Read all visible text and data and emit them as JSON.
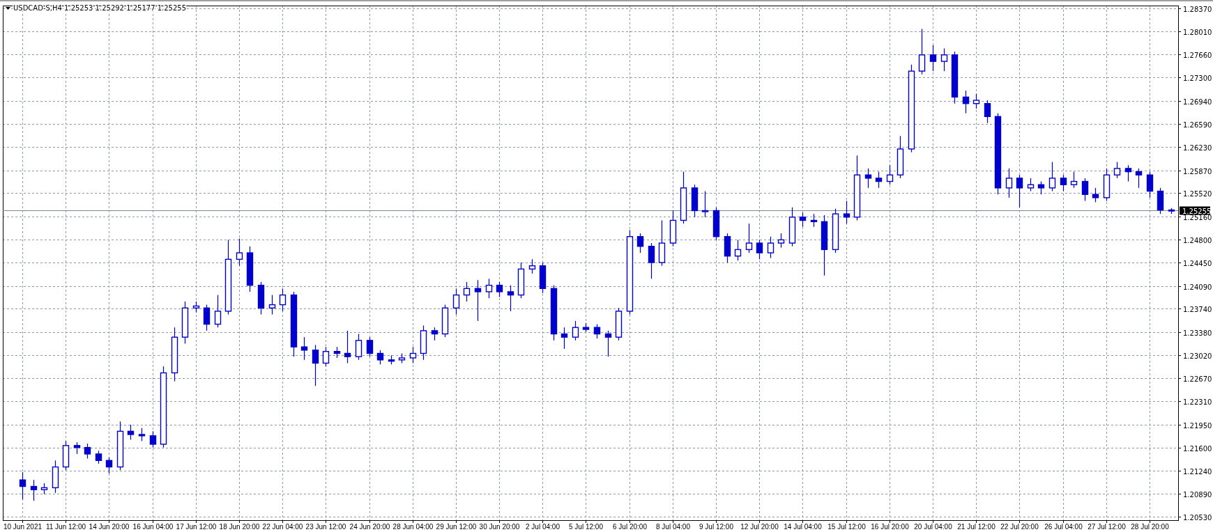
{
  "chart": {
    "quote": [
      "1.25253",
      "1.25292",
      "1.25177",
      "1.25255"
    ],
    "chart_data": {
      "type": "candlestick",
      "title": "USDCAD-S,H4",
      "grid": true,
      "ylim": [
        1.2048,
        1.2841
      ],
      "categories": [
        "10 Jun 2021",
        null,
        null,
        null,
        "11 Jun 12:00",
        null,
        null,
        null,
        "14 Jun 20:00",
        null,
        null,
        null,
        "16 Jun 04:00",
        null,
        null,
        null,
        "17 Jun 12:00",
        null,
        null,
        null,
        "18 Jun 20:00",
        null,
        null,
        null,
        "22 Jun 04:00",
        null,
        null,
        null,
        "23 Jun 12:00",
        null,
        null,
        null,
        "24 Jun 20:00",
        null,
        null,
        null,
        "28 Jun 04:00",
        null,
        null,
        null,
        "29 Jun 12:00",
        null,
        null,
        null,
        "30 Jun 20:00",
        null,
        null,
        null,
        "2 Jul 04:00",
        null,
        null,
        null,
        "5 Jul 12:00",
        null,
        null,
        null,
        "6 Jul 20:00",
        null,
        null,
        null,
        "8 Jul 04:00",
        null,
        null,
        null,
        "9 Jul 12:00",
        null,
        null,
        null,
        "12 Jul 20:00",
        null,
        null,
        null,
        "14 Jul 04:00",
        null,
        null,
        null,
        "15 Jul 12:00",
        null,
        null,
        null,
        "16 Jul 20:00",
        null,
        null,
        null,
        "20 Jul 04:00",
        null,
        null,
        null,
        "21 Jul 12:00",
        null,
        null,
        null,
        "22 Jul 20:00",
        null,
        null,
        null,
        "26 Jul 04:00",
        null,
        null,
        null,
        "27 Jul 12:00",
        null,
        null,
        null,
        "28 Jul 20:00",
        null,
        null
      ],
      "ohlc": [
        [
          1.211,
          1.2122,
          1.208,
          1.21
        ],
        [
          1.21,
          1.211,
          1.2078,
          1.2095
        ],
        [
          1.2095,
          1.2105,
          1.2088,
          1.2098
        ],
        [
          1.2098,
          1.214,
          1.209,
          1.213
        ],
        [
          1.213,
          1.217,
          1.2125,
          1.2163
        ],
        [
          1.2163,
          1.2168,
          1.215,
          1.216
        ],
        [
          1.216,
          1.2166,
          1.2143,
          1.215
        ],
        [
          1.215,
          1.2155,
          1.2135,
          1.214
        ],
        [
          1.214,
          1.2145,
          1.212,
          1.213
        ],
        [
          1.213,
          1.22,
          1.2125,
          1.2185
        ],
        [
          1.2185,
          1.2195,
          1.2172,
          1.218
        ],
        [
          1.218,
          1.219,
          1.217,
          1.2178
        ],
        [
          1.2178,
          1.2185,
          1.216,
          1.2165
        ],
        [
          1.2165,
          1.2285,
          1.216,
          1.2275
        ],
        [
          1.2275,
          1.2345,
          1.2262,
          1.233
        ],
        [
          1.233,
          1.2385,
          1.232,
          1.2375
        ],
        [
          1.2375,
          1.2385,
          1.2368,
          1.2378
        ],
        [
          1.2375,
          1.238,
          1.234,
          1.235
        ],
        [
          1.235,
          1.2395,
          1.2345,
          1.237
        ],
        [
          1.237,
          1.248,
          1.2365,
          1.245
        ],
        [
          1.245,
          1.2482,
          1.244,
          1.246
        ],
        [
          1.246,
          1.247,
          1.24,
          1.241
        ],
        [
          1.241,
          1.2415,
          1.2365,
          1.2375
        ],
        [
          1.2375,
          1.2395,
          1.2365,
          1.238
        ],
        [
          1.238,
          1.2405,
          1.237,
          1.2395
        ],
        [
          1.2395,
          1.24,
          1.23,
          1.2315
        ],
        [
          1.2315,
          1.233,
          1.2295,
          1.231
        ],
        [
          1.231,
          1.2318,
          1.2255,
          1.229
        ],
        [
          1.229,
          1.2315,
          1.2285,
          1.2308
        ],
        [
          1.2308,
          1.2315,
          1.2298,
          1.2305
        ],
        [
          1.2305,
          1.234,
          1.229,
          1.23
        ],
        [
          1.23,
          1.2335,
          1.2295,
          1.2325
        ],
        [
          1.2325,
          1.233,
          1.23,
          1.2305
        ],
        [
          1.2305,
          1.231,
          1.2288,
          1.2295
        ],
        [
          1.2295,
          1.2302,
          1.2288,
          1.2293
        ],
        [
          1.2295,
          1.2305,
          1.229,
          1.2298
        ],
        [
          1.2298,
          1.2315,
          1.229,
          1.2305
        ],
        [
          1.2305,
          1.2348,
          1.2295,
          1.234
        ],
        [
          1.234,
          1.2345,
          1.2325,
          1.2335
        ],
        [
          1.2335,
          1.238,
          1.233,
          1.2375
        ],
        [
          1.2375,
          1.2405,
          1.2365,
          1.2395
        ],
        [
          1.2395,
          1.2415,
          1.2385,
          1.2405
        ],
        [
          1.2405,
          1.2418,
          1.2355,
          1.24
        ],
        [
          1.24,
          1.242,
          1.239,
          1.241
        ],
        [
          1.241,
          1.2415,
          1.2392,
          1.24
        ],
        [
          1.24,
          1.241,
          1.237,
          1.2395
        ],
        [
          1.2395,
          1.2445,
          1.239,
          1.2435
        ],
        [
          1.2435,
          1.245,
          1.2428,
          1.244
        ],
        [
          1.244,
          1.2445,
          1.2398,
          1.2405
        ],
        [
          1.2405,
          1.241,
          1.2325,
          1.2335
        ],
        [
          1.2335,
          1.2345,
          1.2312,
          1.233
        ],
        [
          1.233,
          1.2355,
          1.2325,
          1.2345
        ],
        [
          1.2345,
          1.2352,
          1.2338,
          1.2342
        ],
        [
          1.2345,
          1.235,
          1.2328,
          1.2335
        ],
        [
          1.2335,
          1.234,
          1.23,
          1.233
        ],
        [
          1.233,
          1.2375,
          1.2325,
          1.237
        ],
        [
          1.237,
          1.2495,
          1.2365,
          1.2485
        ],
        [
          1.2485,
          1.249,
          1.246,
          1.247
        ],
        [
          1.247,
          1.2475,
          1.242,
          1.2445
        ],
        [
          1.2445,
          1.251,
          1.244,
          1.2475
        ],
        [
          1.2475,
          1.2525,
          1.247,
          1.251
        ],
        [
          1.251,
          1.2585,
          1.2505,
          1.256
        ],
        [
          1.256,
          1.2565,
          1.2515,
          1.2525
        ],
        [
          1.2525,
          1.2555,
          1.2515,
          1.2525
        ],
        [
          1.2525,
          1.253,
          1.248,
          1.2485
        ],
        [
          1.2485,
          1.249,
          1.2445,
          1.2455
        ],
        [
          1.2455,
          1.248,
          1.2448,
          1.2465
        ],
        [
          1.2465,
          1.2505,
          1.246,
          1.2475
        ],
        [
          1.2475,
          1.248,
          1.245,
          1.246
        ],
        [
          1.246,
          1.2485,
          1.2452,
          1.2475
        ],
        [
          1.2475,
          1.249,
          1.2468,
          1.248
        ],
        [
          1.2475,
          1.253,
          1.247,
          1.2515
        ],
        [
          1.2515,
          1.2522,
          1.25,
          1.251
        ],
        [
          1.251,
          1.252,
          1.25,
          1.2508
        ],
        [
          1.2508,
          1.2518,
          1.2425,
          1.2465
        ],
        [
          1.2465,
          1.2528,
          1.246,
          1.252
        ],
        [
          1.252,
          1.254,
          1.2505,
          1.2515
        ],
        [
          1.2515,
          1.261,
          1.251,
          1.258
        ],
        [
          1.258,
          1.259,
          1.256,
          1.2575
        ],
        [
          1.2575,
          1.2585,
          1.256,
          1.257
        ],
        [
          1.257,
          1.2595,
          1.2565,
          1.258
        ],
        [
          1.258,
          1.264,
          1.2575,
          1.262
        ],
        [
          1.262,
          1.275,
          1.2615,
          1.274
        ],
        [
          1.274,
          1.2805,
          1.2735,
          1.2765
        ],
        [
          1.2765,
          1.278,
          1.274,
          1.2755
        ],
        [
          1.2755,
          1.2775,
          1.274,
          1.2765
        ],
        [
          1.2765,
          1.277,
          1.269,
          1.27
        ],
        [
          1.27,
          1.271,
          1.2675,
          1.269
        ],
        [
          1.269,
          1.2705,
          1.2682,
          1.2695
        ],
        [
          1.269,
          1.2695,
          1.266,
          1.267
        ],
        [
          1.267,
          1.2675,
          1.255,
          1.256
        ],
        [
          1.256,
          1.259,
          1.2545,
          1.2575
        ],
        [
          1.2575,
          1.258,
          1.253,
          1.256
        ],
        [
          1.256,
          1.2575,
          1.2555,
          1.2565
        ],
        [
          1.2565,
          1.257,
          1.255,
          1.256
        ],
        [
          1.256,
          1.26,
          1.2555,
          1.2575
        ],
        [
          1.2575,
          1.258,
          1.2555,
          1.2565
        ],
        [
          1.2565,
          1.2585,
          1.256,
          1.257
        ],
        [
          1.257,
          1.2575,
          1.254,
          1.255
        ],
        [
          1.255,
          1.256,
          1.2538,
          1.2545
        ],
        [
          1.2545,
          1.259,
          1.254,
          1.258
        ],
        [
          1.258,
          1.26,
          1.2575,
          1.259
        ],
        [
          1.259,
          1.2595,
          1.257,
          1.2585
        ],
        [
          1.2585,
          1.259,
          1.256,
          1.258
        ],
        [
          1.258,
          1.2585,
          1.2545,
          1.2555
        ],
        [
          1.2555,
          1.256,
          1.252,
          1.2526
        ],
        [
          1.2526,
          1.2529,
          1.252,
          1.2525
        ]
      ],
      "yticks": [
        {
          "value": 1.2837,
          "label": "1.28370"
        },
        {
          "value": 1.2801,
          "label": "1.28010"
        },
        {
          "value": 1.2766,
          "label": "1.27660"
        },
        {
          "value": 1.273,
          "label": "1.27300"
        },
        {
          "value": 1.2694,
          "label": "1.26940"
        },
        {
          "value": 1.2659,
          "label": "1.26590"
        },
        {
          "value": 1.2623,
          "label": "1.26230"
        },
        {
          "value": 1.2587,
          "label": "1.25870"
        },
        {
          "value": 1.2552,
          "label": "1.25520"
        },
        {
          "value": 1.2516,
          "label": "1.25160"
        },
        {
          "value": 1.248,
          "label": "1.24800"
        },
        {
          "value": 1.2445,
          "label": "1.24450"
        },
        {
          "value": 1.2409,
          "label": "1.24090"
        },
        {
          "value": 1.2374,
          "label": "1.23740"
        },
        {
          "value": 1.2338,
          "label": "1.23380"
        },
        {
          "value": 1.2302,
          "label": "1.23020"
        },
        {
          "value": 1.2267,
          "label": "1.22670"
        },
        {
          "value": 1.2231,
          "label": "1.22310"
        },
        {
          "value": 1.2195,
          "label": "1.21950"
        },
        {
          "value": 1.216,
          "label": "1.21600"
        },
        {
          "value": 1.2124,
          "label": "1.21240"
        },
        {
          "value": 1.2089,
          "label": "1.20890"
        },
        {
          "value": 1.2053,
          "label": "1.20530"
        }
      ],
      "ref_lines": [
        {
          "axis": "y",
          "value": 1.25255,
          "label": "1.25255"
        }
      ]
    }
  }
}
